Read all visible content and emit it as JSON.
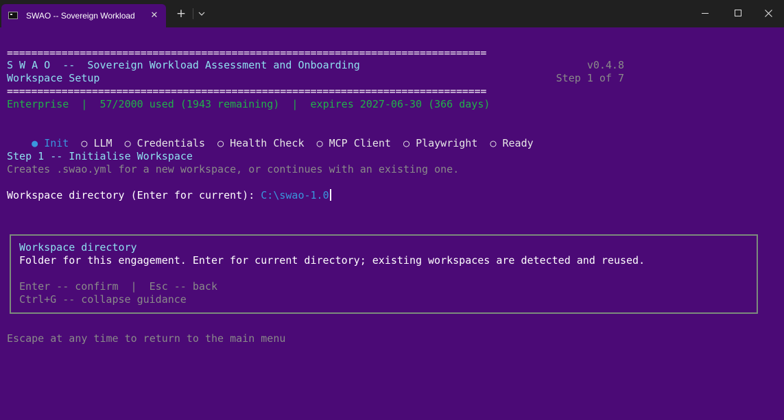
{
  "window": {
    "tab_title": "SWAO -- Sovereign Workload",
    "tab_close_glyph": "✕",
    "new_tab_glyph": "+"
  },
  "header": {
    "rule": "===============================================================================",
    "title": "S W A O  --  Sovereign Workload Assessment and Onboarding",
    "version": "v0.4.8",
    "subtitle": "Workspace Setup",
    "step_counter": "Step 1 of 7"
  },
  "license": {
    "text": "Enterprise  |  57/2000 used (1943 remaining)  |  expires 2027-06-30 (366 days)"
  },
  "steps": [
    {
      "label": "Init",
      "current": true
    },
    {
      "label": "LLM",
      "current": false
    },
    {
      "label": "Credentials",
      "current": false
    },
    {
      "label": "Health Check",
      "current": false
    },
    {
      "label": "MCP Client",
      "current": false
    },
    {
      "label": "Playwright",
      "current": false
    },
    {
      "label": "Ready",
      "current": false
    }
  ],
  "step_markers": {
    "current": "●",
    "pending": "○"
  },
  "section": {
    "heading": "Step 1 -- Initialise Workspace",
    "description": "Creates .swao.yml for a new workspace, or continues with an existing one."
  },
  "prompt": {
    "label": "Workspace directory (Enter for current): ",
    "value": "C:\\swao-1.0"
  },
  "guidance": {
    "title": "Workspace directory",
    "body": "Folder for this engagement. Enter for current directory; existing workspaces are detected and reused.",
    "keys_line1": "Enter -- confirm  |  Esc -- back",
    "keys_line2": "Ctrl+G -- collapse guidance"
  },
  "footer": {
    "hint": "Escape at any time to return to the main menu"
  },
  "colors": {
    "background": "#4b0a76",
    "titlebar": "#202020",
    "heading_cyan": "#8fe0f0",
    "license_green": "#22b14a",
    "accent_blue": "#3a96dd",
    "muted_grey": "#8a8a8a",
    "guide_border": "#7c8c7c"
  }
}
